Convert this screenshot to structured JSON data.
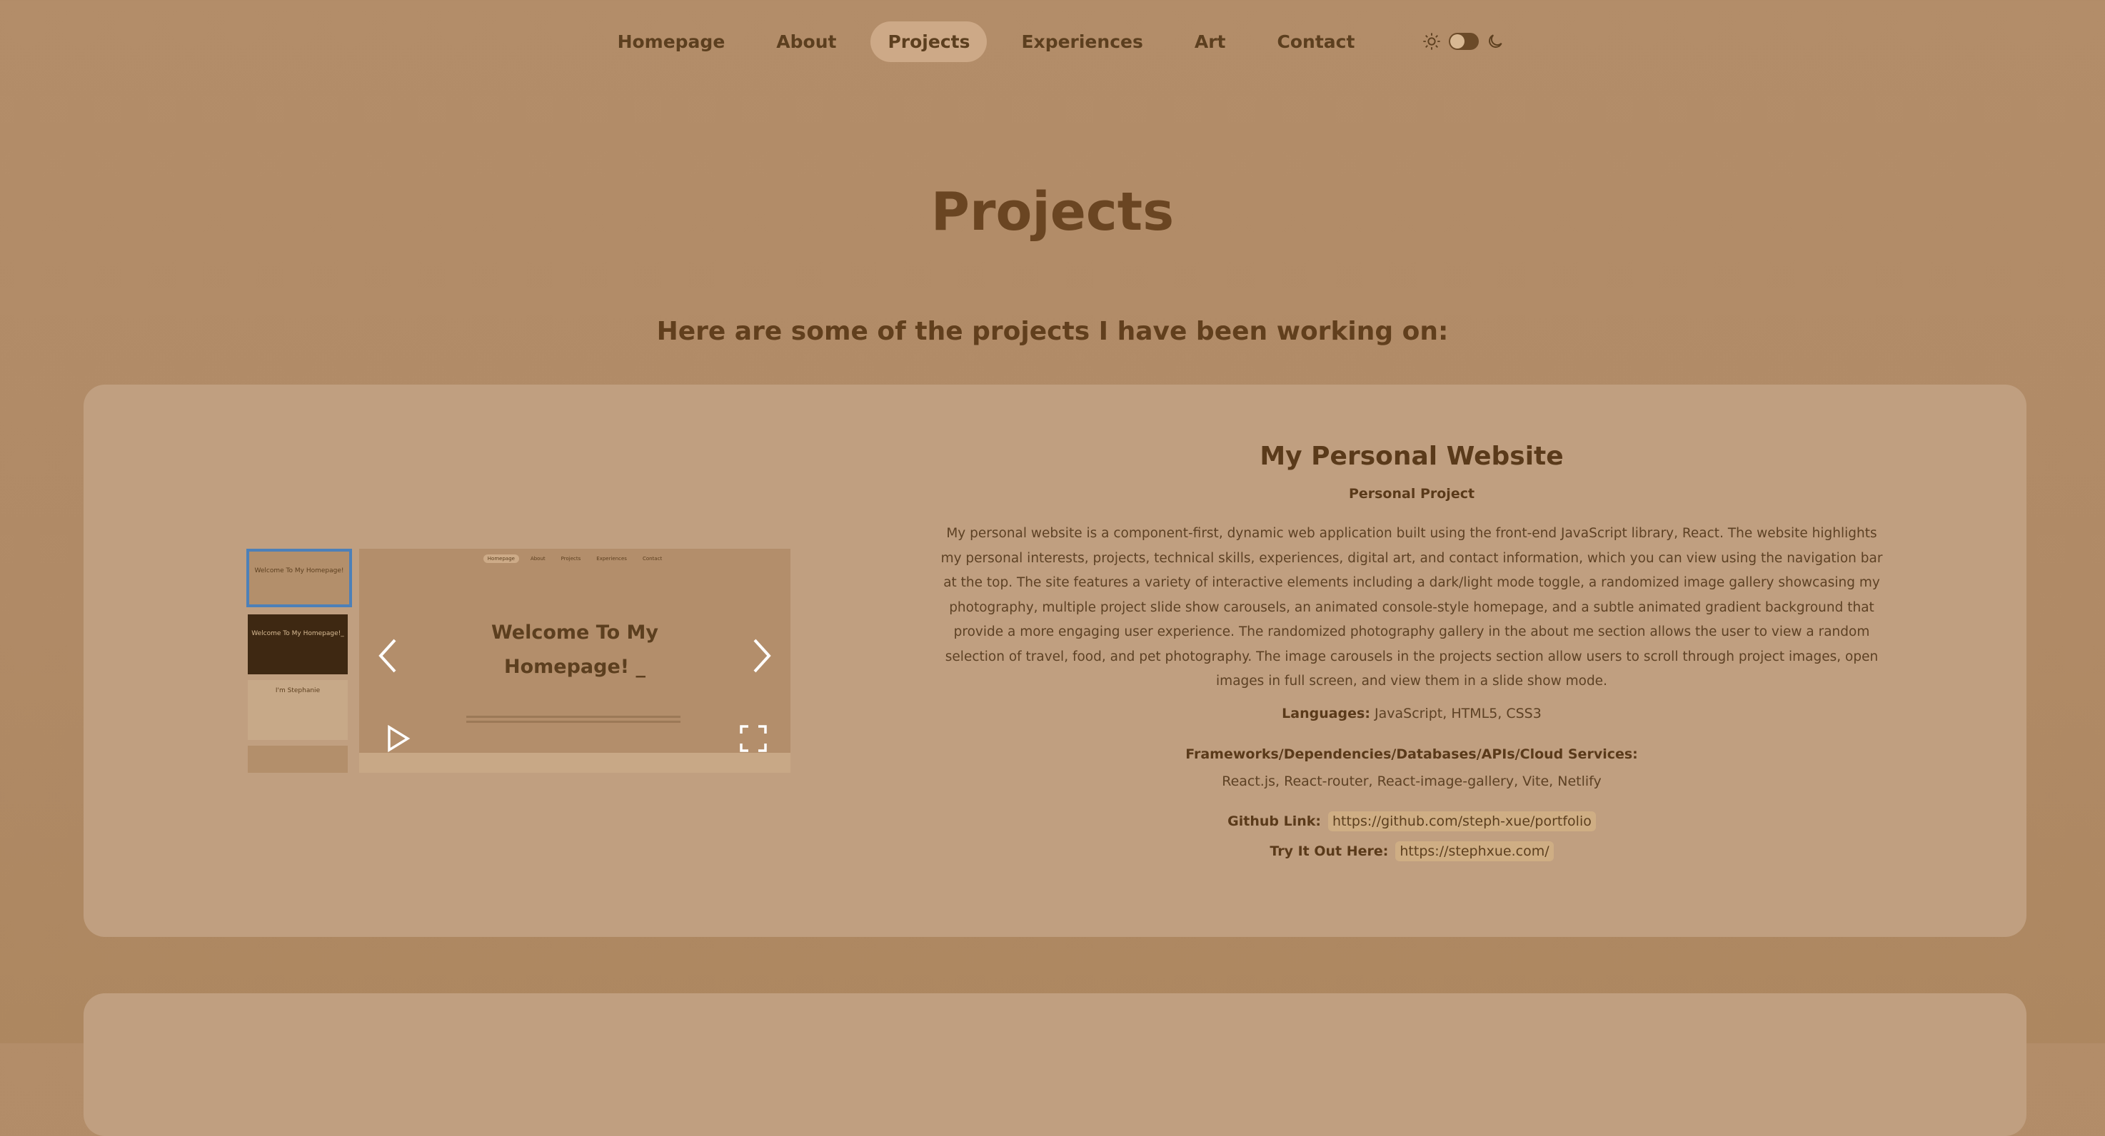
{
  "nav": {
    "items": [
      "Homepage",
      "About",
      "Projects",
      "Experiences",
      "Art",
      "Contact"
    ],
    "active": "Projects"
  },
  "page": {
    "title": "Projects",
    "subtitle": "Here are some of the projects I have been working on:"
  },
  "project": {
    "title": "My Personal Website",
    "category": "Personal Project",
    "description": "My personal website is a component-first, dynamic web application built using the front-end JavaScript library, React. The website highlights my personal interests, projects, technical skills, experiences, digital art, and contact information, which you can view using the navigation bar at the top. The site features a variety of interactive elements including a dark/light mode toggle, a randomized image gallery showcasing my photography, multiple project slide show carousels, an animated console-style homepage, and a subtle animated gradient background that provide a more engaging user experience. The randomized photography gallery in the about me section allows the user to view a random selection of travel, food, and pet photography. The image carousels in the projects section allow users to scroll through project images, open images in full screen, and view them in a slide show mode.",
    "languages_label": "Languages:",
    "languages": "JavaScript, HTML5, CSS3",
    "frameworks_label": "Frameworks/Dependencies/Databases/APIs/Cloud Services:",
    "frameworks": "React.js, React-router, React-image-gallery, Vite, Netlify",
    "github_label": "Github Link:",
    "github_url": "https://github.com/steph-xue/portfolio",
    "try_label": "Try It Out Here:",
    "try_url": "https://stephxue.com/"
  },
  "gallery": {
    "main_caption_line1": "Welcome To My",
    "main_caption_line2": "Homepage! _",
    "thumb1_text": "Welcome To My Homepage!",
    "thumb2_text": "Welcome To My Homepage!_",
    "thumb3_text": "I'm Stephanie",
    "mini_nav": [
      "Homepage",
      "About",
      "Projects",
      "Experiences",
      "Contact"
    ]
  },
  "icons": {
    "sun": "sun-icon",
    "moon": "moon-icon",
    "prev": "chevron-left-icon",
    "next": "chevron-right-icon",
    "play": "play-icon",
    "fullscreen": "fullscreen-icon"
  },
  "colors": {
    "background": "#b08a66",
    "card": "#c09f80",
    "active_nav": "#cda987",
    "selected_thumb_border": "#4d80b8",
    "text": "#5a3a1a"
  }
}
